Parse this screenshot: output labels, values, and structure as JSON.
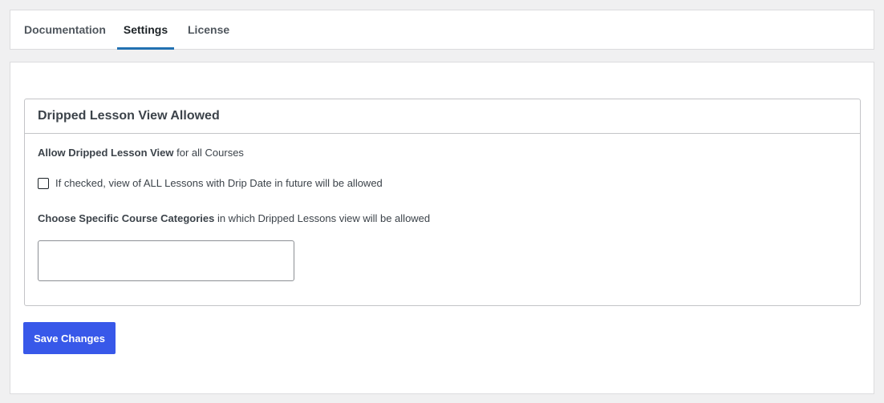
{
  "tabs": [
    {
      "label": "Documentation",
      "active": false
    },
    {
      "label": "Settings",
      "active": true
    },
    {
      "label": "License",
      "active": false
    }
  ],
  "card": {
    "title": "Dripped Lesson View Allowed",
    "allow_label_bold": "Allow Dripped Lesson View",
    "allow_label_rest": " for all Courses",
    "checkbox_label": "If checked, view of ALL Lessons with Drip Date in future will be allowed",
    "checkbox_checked": false,
    "categories_label_bold": "Choose Specific Course Categories",
    "categories_label_rest": " in which Dripped Lessons view will be allowed",
    "categories_selected": []
  },
  "save_button": {
    "label": "Save Changes"
  },
  "colors": {
    "accent": "#2271b1",
    "button": "#3858e9",
    "background": "#f0f0f1"
  }
}
